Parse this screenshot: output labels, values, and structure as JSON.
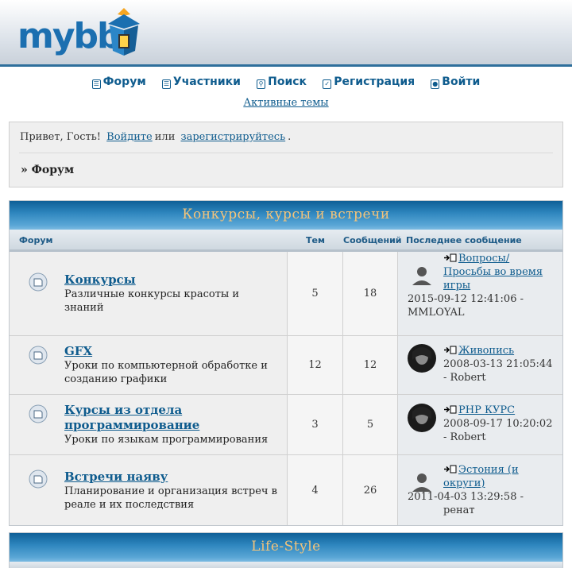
{
  "header": {
    "logo_text": "mybb"
  },
  "nav": {
    "items": [
      {
        "label": "Форум"
      },
      {
        "label": "Участники"
      },
      {
        "label": "Поиск"
      },
      {
        "label": "Регистрация"
      },
      {
        "label": "Войти"
      }
    ],
    "active_topics": "Активные темы"
  },
  "welcome": {
    "greeting": "Привет, Гость!",
    "login": "Войдите",
    "or": "или",
    "register": "зарегистрируйтесь",
    "dot": ".",
    "breadcrumb": "» Форум"
  },
  "categories": [
    {
      "title": "Конкурсы, курсы и встречи",
      "columns": {
        "forum": "Форум",
        "topics": "Тем",
        "posts": "Сообщений",
        "last": "Последнее сообщение"
      },
      "forums": [
        {
          "name": "Конкурсы",
          "desc": "Различные конкурсы красоты и знаний",
          "topics": "5",
          "posts": "18",
          "last_title": "Вопросы/ Просьбы во время игры",
          "last_meta": "2015-09-12 12:41:06 - MMLOYAL",
          "avatar": "default-avatar"
        },
        {
          "name": "GFX",
          "desc": "Уроки по компьютерной обработке и созданию графики",
          "topics": "12",
          "posts": "12",
          "last_title": "Живопись",
          "last_meta": "2008-03-13 21:05:44 - Robert",
          "avatar": "photo-avatar"
        },
        {
          "name": "Курсы из отдела программирование",
          "desc": "Уроки по языкам программирования",
          "topics": "3",
          "posts": "5",
          "last_title": "PHP КУРС",
          "last_meta": "2008-09-17 10:20:02 - Robert",
          "avatar": "photo-avatar"
        },
        {
          "name": "Встречи наяву",
          "desc": "Планирование и организация встреч в реале и их последствия",
          "topics": "4",
          "posts": "26",
          "last_title": "Эстония (и округи)",
          "last_meta": "2011-04-03 13:29:58 - ренат",
          "avatar": "default-avatar"
        }
      ]
    },
    {
      "title": "Life-Style"
    }
  ],
  "colors": {
    "accent": "#0f5c8e",
    "category_title": "#f5c47a",
    "header_border": "#2e6f9c"
  }
}
